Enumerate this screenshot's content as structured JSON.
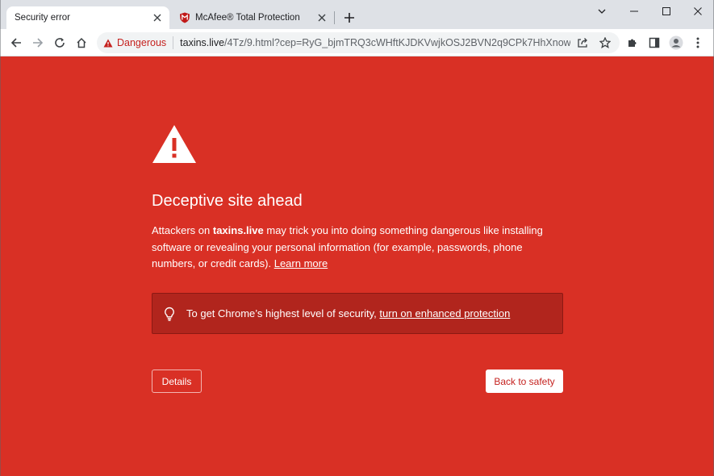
{
  "tabs": [
    {
      "title": "Security error",
      "active": true
    },
    {
      "title": "McAfee® Total Protection",
      "active": false,
      "favicon": "mcafee-shield-icon"
    }
  ],
  "toolbar": {
    "security_chip_label": "Dangerous",
    "url_host": "taxins.live",
    "url_path": "/4Tz/9.html?cep=RyG_bjmTRQ3cWHftKJDKVwjkOSJ2BVN2q9CPk7HhXnowH73H..."
  },
  "page": {
    "heading": "Deceptive site ahead",
    "desc_prefix": "Attackers on ",
    "desc_site": "taxins.live",
    "desc_body": " may trick you into doing something dangerous like installing software or revealing your personal information (for example, passwords, phone numbers, or credit cards). ",
    "learn_more": "Learn more",
    "promo_text": "To get Chrome’s highest level of security, ",
    "promo_link": "turn on enhanced protection",
    "details_button": "Details",
    "back_button": "Back to safety"
  },
  "colors": {
    "page_background": "#d93025",
    "danger_text": "#c5221f",
    "promo_background": "#b1251d"
  }
}
